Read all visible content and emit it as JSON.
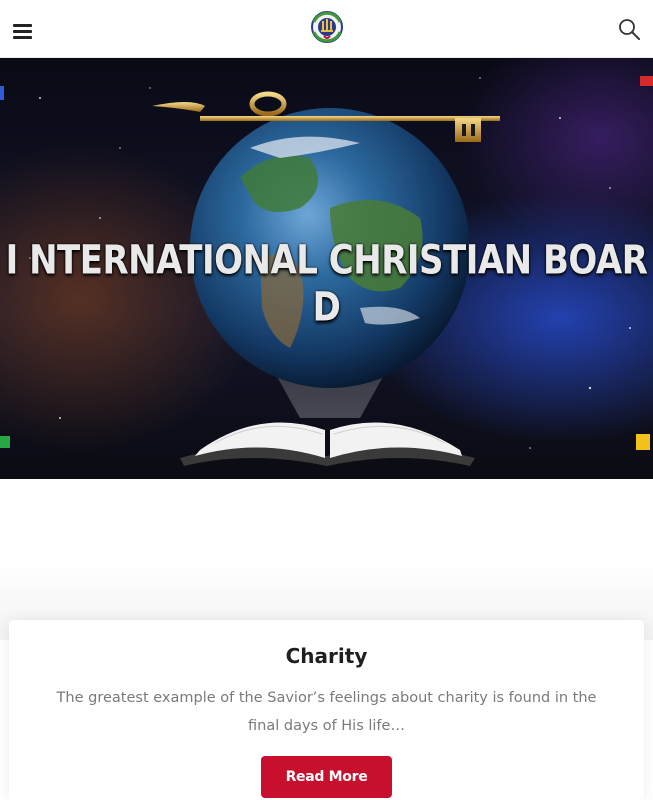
{
  "header": {
    "menu_icon": "hamburger-menu-icon",
    "logo_icon": "organization-logo",
    "search_icon": "search-icon"
  },
  "hero": {
    "title": "I NTERNATIONAL CHRISTIAN BOAR D"
  },
  "card": {
    "title": "Charity",
    "text": "The greatest example of the Savior’s feelings about charity is found in the final days of His life…",
    "button_label": "Read More"
  },
  "colors": {
    "accent": "#c8102e",
    "text_muted": "#7a7a7a",
    "title": "#1f1f1f"
  }
}
